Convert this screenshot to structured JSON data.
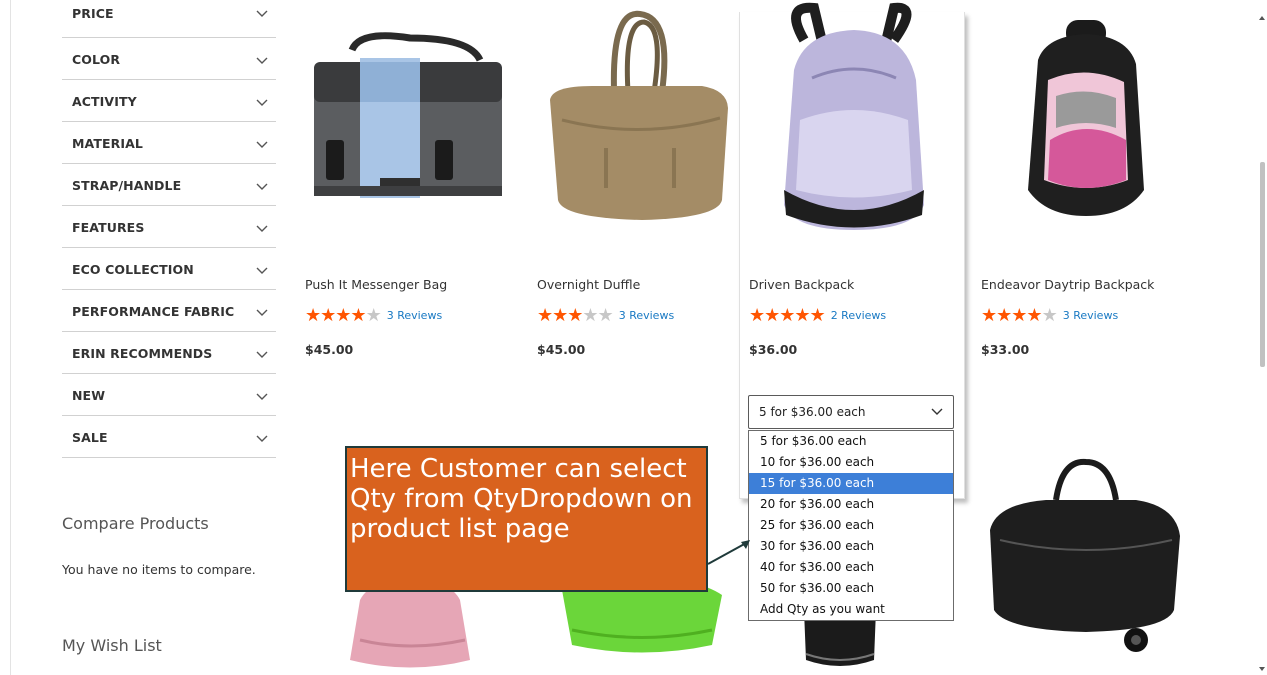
{
  "filters": [
    {
      "label": "PRICE"
    },
    {
      "label": "COLOR"
    },
    {
      "label": "ACTIVITY"
    },
    {
      "label": "MATERIAL"
    },
    {
      "label": "STRAP/HANDLE"
    },
    {
      "label": "FEATURES"
    },
    {
      "label": "ECO COLLECTION"
    },
    {
      "label": "PERFORMANCE FABRIC"
    },
    {
      "label": "ERIN RECOMMENDS"
    },
    {
      "label": "NEW"
    },
    {
      "label": "SALE"
    }
  ],
  "compare": {
    "title": "Compare Products",
    "empty_text": "You have no items to compare."
  },
  "wishlist": {
    "title": "My Wish List"
  },
  "products": [
    {
      "name": "Push It Messenger Bag",
      "rating_stars": 3.5,
      "reviews": "3 Reviews",
      "price": "$45.00",
      "image": "messenger-bag-image"
    },
    {
      "name": "Overnight Duffle",
      "rating_stars": 3,
      "reviews": "3 Reviews",
      "price": "$45.00",
      "image": "duffle-bag-image"
    },
    {
      "name": "Driven Backpack",
      "rating_stars": 4.5,
      "reviews": "2 Reviews",
      "price": "$36.00",
      "image": "backpack-image"
    },
    {
      "name": "Endeavor Daytrip Backpack",
      "rating_stars": 3.5,
      "reviews": "3 Reviews",
      "price": "$33.00",
      "image": "daytrip-backpack-image"
    }
  ],
  "qty_dropdown": {
    "selected": "5 for $36.00 each",
    "highlighted_index": 2,
    "options": [
      "5 for $36.00 each",
      "10 for $36.00 each",
      "15 for $36.00 each",
      "20 for $36.00 each",
      "25 for $36.00 each",
      "30 for $36.00 each",
      "40 for $36.00 each",
      "50 for $36.00 each",
      "Add Qty as you want"
    ]
  },
  "callout": {
    "text": "Here Customer can select Qty from QtyDropdown on product list page"
  },
  "colors": {
    "star": "#ff5501",
    "link": "#1979c3",
    "callout_bg": "#d9621e",
    "highlight": "#3d7fd8"
  }
}
